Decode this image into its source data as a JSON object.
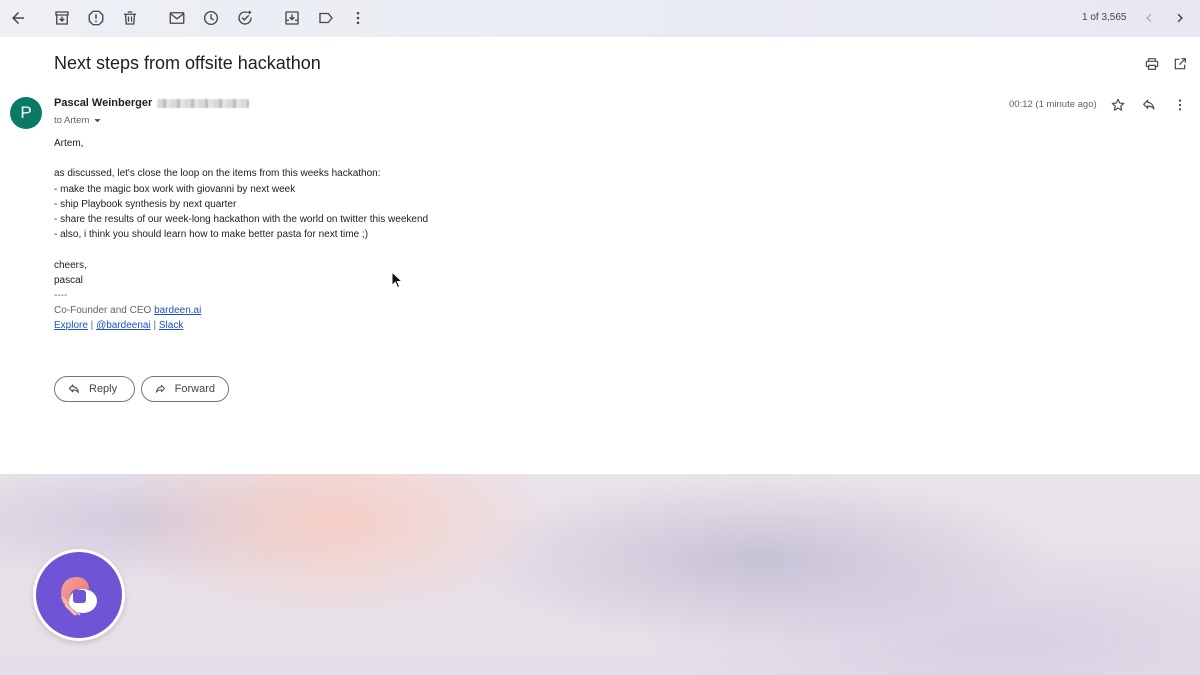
{
  "toolbar": {
    "pager_text": "1 of 3,565",
    "icons": [
      "back-arrow-icon",
      "archive-icon",
      "report-spam-icon",
      "delete-icon",
      "mark-unread-icon",
      "snooze-icon",
      "add-task-icon",
      "move-to-icon",
      "label-icon",
      "more-vert-icon",
      "newer-chevron-icon",
      "older-chevron-icon"
    ]
  },
  "email": {
    "subject": "Next steps from offsite hackathon",
    "sender_name": "Pascal Weinberger",
    "avatar_letter": "P",
    "avatar_color": "#0b7a64",
    "to_text": "to Artem",
    "time_text": "00:12 (1 minute ago)",
    "body": {
      "greeting": "Artem,",
      "intro": "as discussed, let's close the loop on the items from this weeks hackathon:",
      "items": [
        "- make the magic box work with giovanni by next week",
        "- ship Playbook synthesis by next quarter",
        "- share the results of our week-long hackathon with the world on twitter this weekend",
        "- also, i think you should learn how to make better pasta for next time ;)"
      ],
      "closing": "cheers,",
      "name": "pascal",
      "separator": "----",
      "signature_prefix": "Co-Founder and CEO ",
      "signature_link": "bardeen.ai",
      "links": [
        "Explore",
        "@bardeenai",
        "Slack"
      ],
      "link_separator": " | "
    }
  },
  "actions": {
    "reply_label": "Reply",
    "forward_label": "Forward"
  },
  "colors": {
    "link": "#1a52c4",
    "badge": "#6f55d6"
  }
}
